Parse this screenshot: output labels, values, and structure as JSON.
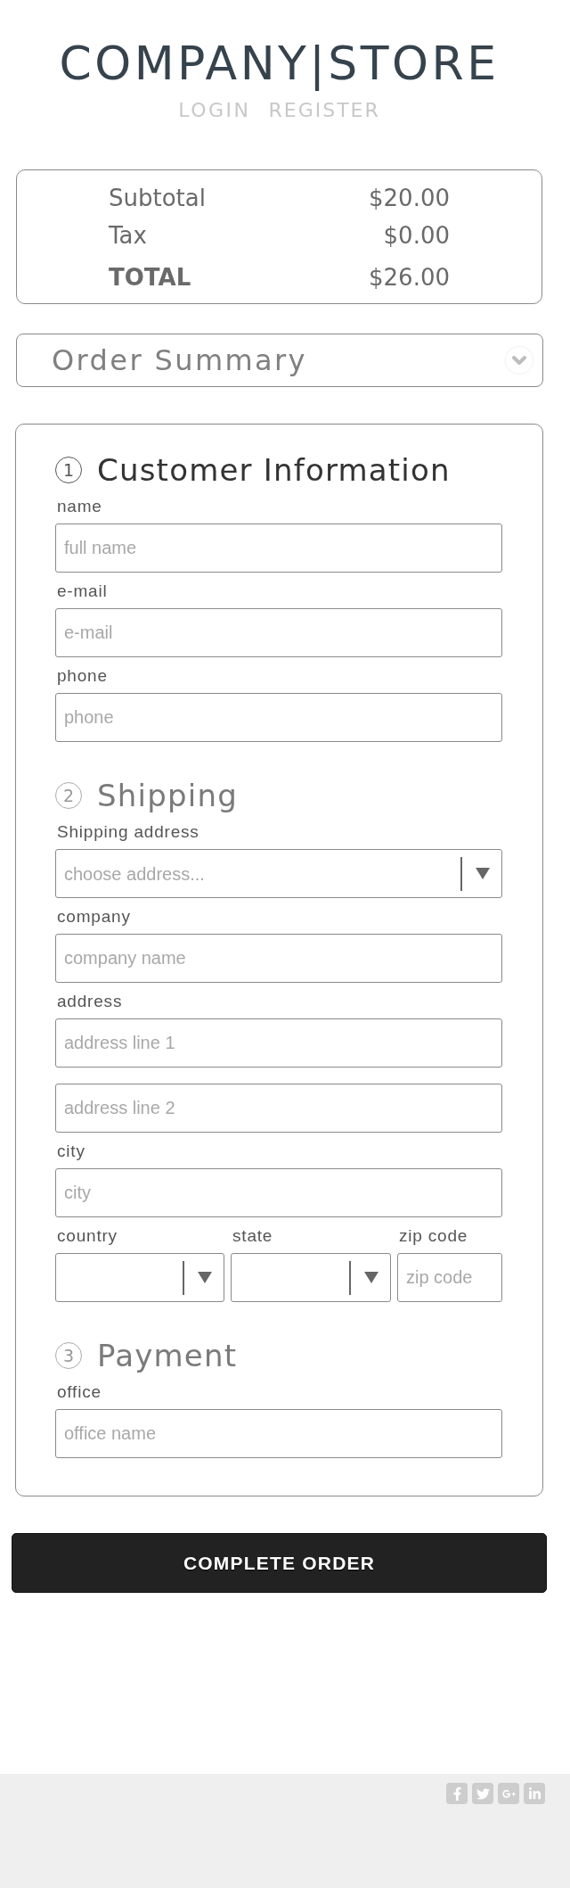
{
  "header": {
    "logo": "COMPANY|STORE",
    "links": [
      {
        "label": "LOGIN"
      },
      {
        "label": "REGISTER"
      }
    ]
  },
  "totals": [
    {
      "kind": "line",
      "label": "Subtotal",
      "value": "$20.00"
    },
    {
      "kind": "line",
      "label": "Tax",
      "value": "$0.00"
    },
    {
      "kind": "total",
      "label": "TOTAL",
      "value": "$26.00"
    }
  ],
  "order_summary": {
    "title": "Order Summary",
    "expanded": false
  },
  "sections": [
    {
      "step": "1",
      "title": "Customer Information",
      "active": true,
      "fields": [
        {
          "kind": "text",
          "label": "name",
          "placeholder": "full name"
        },
        {
          "kind": "text",
          "label": "e-mail",
          "placeholder": "e-mail"
        },
        {
          "kind": "text",
          "label": "phone",
          "placeholder": "phone"
        }
      ]
    },
    {
      "step": "2",
      "title": "Shipping",
      "active": false,
      "fields": [
        {
          "kind": "select",
          "label": "Shipping address",
          "placeholder": "choose address..."
        },
        {
          "kind": "text",
          "label": "company",
          "placeholder": "company name"
        },
        {
          "kind": "text",
          "label": "address",
          "placeholder": "address line 1"
        },
        {
          "kind": "text",
          "placeholder": "address line 2"
        },
        {
          "kind": "text",
          "label": "city",
          "placeholder": "city"
        },
        {
          "kind": "row",
          "fields": [
            {
              "kind": "select",
              "label": "country"
            },
            {
              "kind": "select",
              "label": "state"
            },
            {
              "kind": "text",
              "label": "zip code",
              "placeholder": "zip code"
            }
          ]
        }
      ]
    },
    {
      "step": "3",
      "title": "Payment",
      "active": false,
      "fields": [
        {
          "kind": "text",
          "label": "office",
          "placeholder": "office name"
        }
      ]
    }
  ],
  "submit": {
    "label": "COMPLETE ORDER"
  }
}
